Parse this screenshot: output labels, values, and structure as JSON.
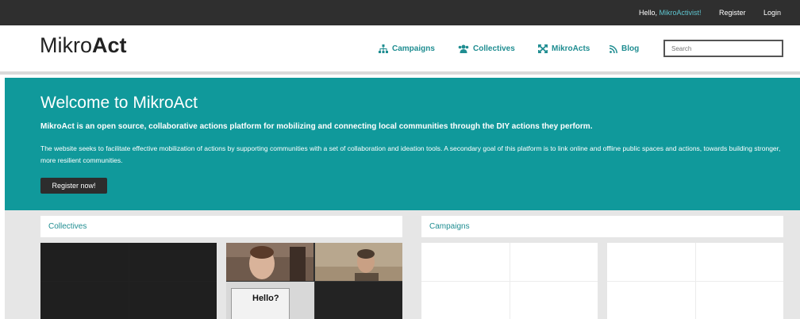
{
  "topbar": {
    "hello_prefix": "Hello, ",
    "username": "MikroActivist!",
    "register": "Register",
    "login": "Login"
  },
  "header": {
    "logo_light": "Mikro",
    "logo_bold": "Act",
    "nav": {
      "campaigns": "Campaigns",
      "collectives": "Collectives",
      "mikroacts": "MikroActs",
      "blog": "Blog"
    },
    "search_placeholder": "Search"
  },
  "hero": {
    "title": "Welcome to MikroAct",
    "lead": "MikroAct is an open source, collaborative actions platform for mobilizing and connecting local communities through the DIY actions they perform.",
    "description": "The website seeks to facilitate effective mobilization of actions by supporting communities with a set of collaboration and ideation tools. A secondary goal of this platform is to link online and offline public spaces and actions, towards building stronger, more resilient communities.",
    "cta": "Register now!"
  },
  "sections": {
    "collectives": "Collectives",
    "campaigns": "Campaigns"
  },
  "photo_tile": {
    "sign_text": "Hello?"
  },
  "colors": {
    "accent": "#10999b",
    "link": "#1f8d91",
    "topbar": "#2f2f2f"
  }
}
